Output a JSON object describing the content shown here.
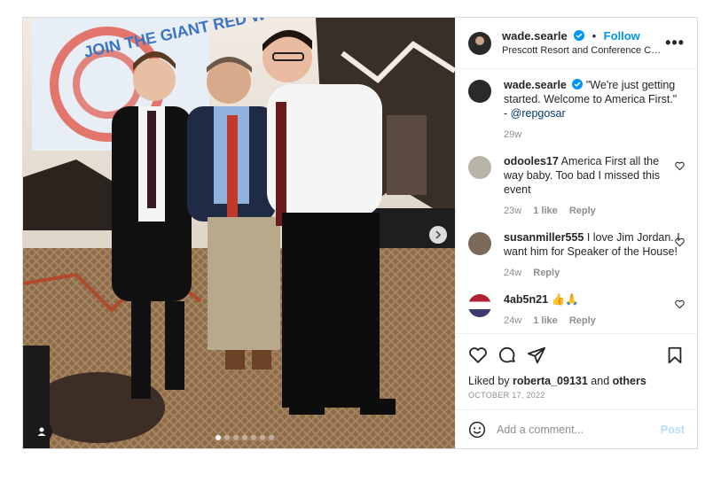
{
  "post": {
    "author": "wade.searle",
    "follow_label": "Follow",
    "separator": "•",
    "location": "Prescott Resort and Conference Cen...",
    "more_label": "•••",
    "banner_text": "JOIN THE GIANT RED W",
    "caption": {
      "username": "wade.searle",
      "text": "\"We're just getting started. Welcome to America First.\" - ",
      "mention": "@repgosar",
      "age": "29w"
    },
    "comments": [
      {
        "username": "odooles17",
        "text": "America First all the way baby. Too bad I missed this event",
        "age": "23w",
        "likes": "1 like",
        "reply": "Reply"
      },
      {
        "username": "susanmiller555",
        "text": "I love Jim Jordan. I want him for Speaker of the House!",
        "age": "24w",
        "likes": "",
        "reply": "Reply"
      },
      {
        "username": "4ab5n21",
        "text": "👍🙏",
        "age": "24w",
        "likes": "1 like",
        "reply": "Reply"
      }
    ],
    "likes_prefix": "Liked by ",
    "liked_by_user": "roberta_09131",
    "likes_middle": " and ",
    "likes_others": "others",
    "date": "OCTOBER 17, 2022",
    "comment_placeholder": "Add a comment...",
    "post_label": "Post",
    "carousel": {
      "total": 7,
      "active": 0
    }
  },
  "colors": {
    "accent": "#0095f6",
    "post_disabled": "#b2dffc",
    "mention": "#00376b",
    "muted": "#8e8e8e"
  },
  "icons": [
    "verified-badge-icon",
    "more-options-icon",
    "next-arrow-icon",
    "user-tag-icon",
    "heart-icon",
    "comment-icon",
    "share-icon",
    "bookmark-icon",
    "emoji-icon"
  ]
}
